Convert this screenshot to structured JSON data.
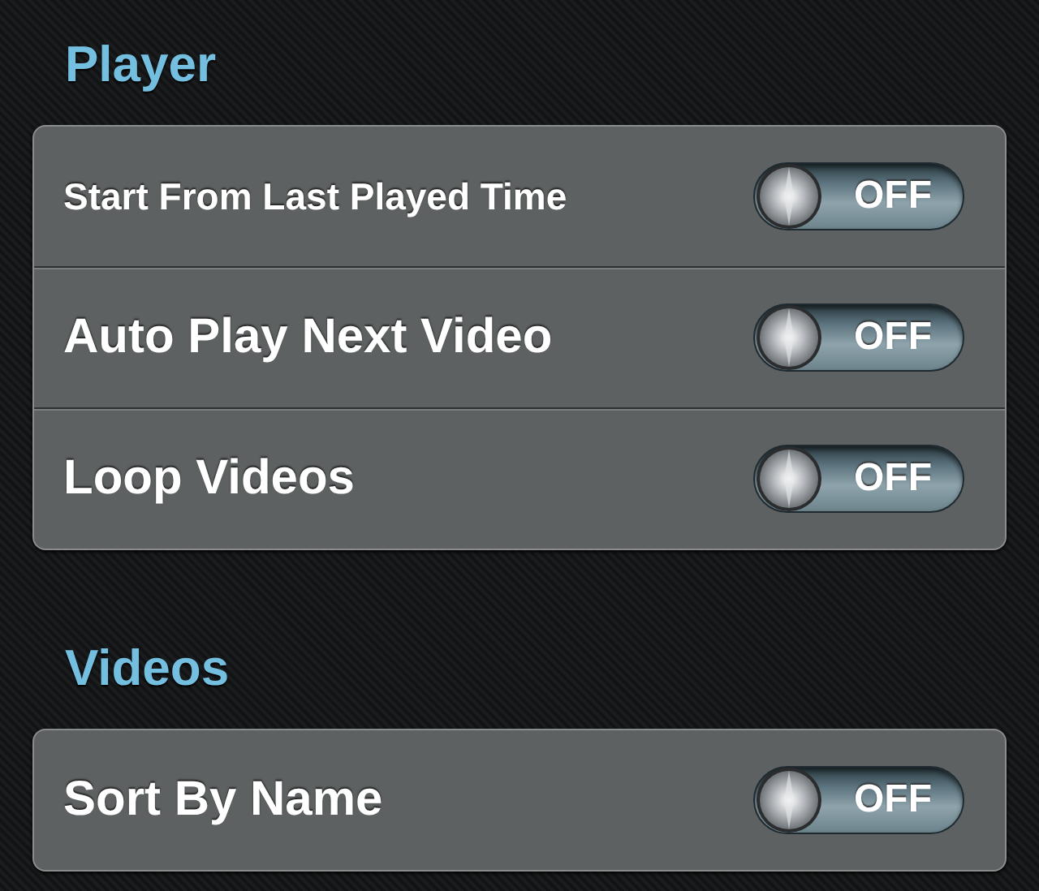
{
  "sections": [
    {
      "title": "Player",
      "rows": [
        {
          "label": "Start From Last Played Time",
          "toggle": {
            "label": "OFF",
            "on": false
          }
        },
        {
          "label": "Auto Play Next Video",
          "toggle": {
            "label": "OFF",
            "on": false
          }
        },
        {
          "label": "Loop Videos",
          "toggle": {
            "label": "OFF",
            "on": false
          }
        }
      ]
    },
    {
      "title": "Videos",
      "rows": [
        {
          "label": "Sort By Name",
          "toggle": {
            "label": "OFF",
            "on": false
          }
        }
      ]
    }
  ]
}
